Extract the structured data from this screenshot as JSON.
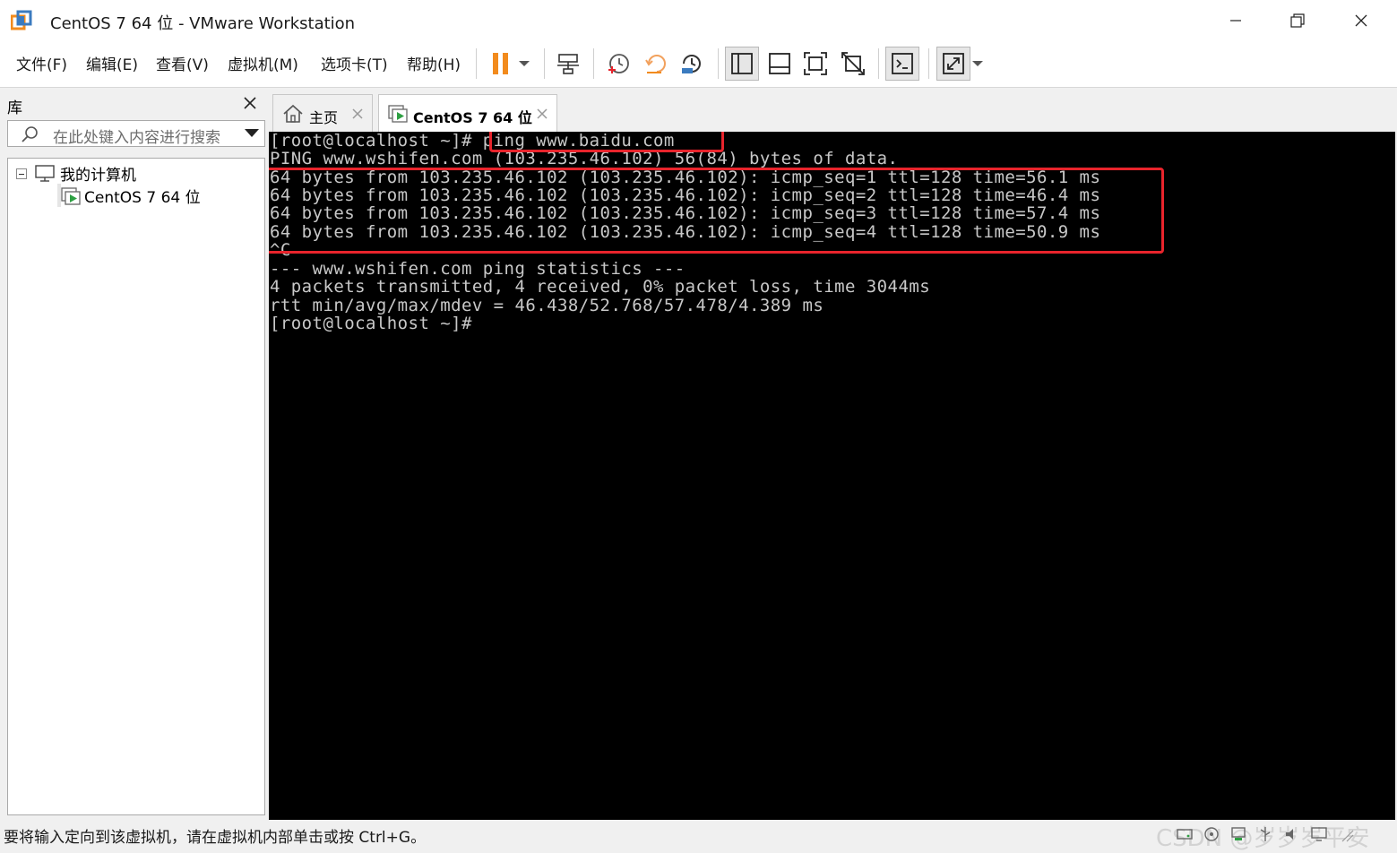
{
  "window": {
    "title": "CentOS 7 64 位 - VMware Workstation"
  },
  "menu": [
    {
      "label": "文件(F)"
    },
    {
      "label": "编辑(E)"
    },
    {
      "label": "查看(V)"
    },
    {
      "label": "虚拟机(M)"
    },
    {
      "label": "选项卡(T)"
    },
    {
      "label": "帮助(H)"
    }
  ],
  "library": {
    "title": "库",
    "search_placeholder": "在此处键入内容进行搜索",
    "tree": {
      "root_label": "我的计算机",
      "vm_label": "CentOS 7 64 位"
    }
  },
  "tabs": [
    {
      "label": "主页",
      "active": false
    },
    {
      "label": "CentOS 7 64 位",
      "active": true
    }
  ],
  "console": {
    "lines": [
      "[root@localhost ~]# ping www.baidu.com",
      "PING www.wshifen.com (103.235.46.102) 56(84) bytes of data.",
      "64 bytes from 103.235.46.102 (103.235.46.102): icmp_seq=1 ttl=128 time=56.1 ms",
      "64 bytes from 103.235.46.102 (103.235.46.102): icmp_seq=2 ttl=128 time=46.4 ms",
      "64 bytes from 103.235.46.102 (103.235.46.102): icmp_seq=3 ttl=128 time=57.4 ms",
      "64 bytes from 103.235.46.102 (103.235.46.102): icmp_seq=4 ttl=128 time=50.9 ms",
      "^C",
      "--- www.wshifen.com ping statistics ---",
      "4 packets transmitted, 4 received, 0% packet loss, time 3044ms",
      "rtt min/avg/max/mdev = 46.438/52.768/57.478/4.389 ms",
      "[root@localhost ~]#"
    ],
    "highlight_color": "#e8242c"
  },
  "status": {
    "text": "要将输入定向到该虚拟机，请在虚拟机内部单击或按 Ctrl+G。",
    "watermark": "CSDN @岁岁岁平安"
  },
  "colors": {
    "accent_orange": "#f28b1d",
    "play_green": "#2ea043",
    "console_bg": "#000000"
  }
}
